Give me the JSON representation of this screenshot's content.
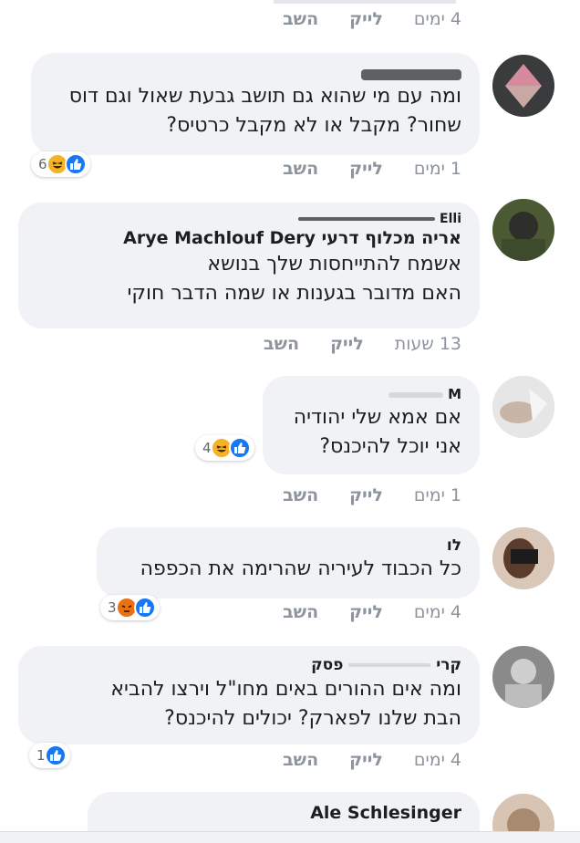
{
  "comments": [
    {
      "time": "4 ימים",
      "like": "לייק",
      "reply": "השב"
    },
    {
      "author": "",
      "text": "ומה עם מי שהוא גם תושב גבעת שאול וגם דוס\nשחור? מקבל או לא מקבל כרטיס?",
      "reaction_count": "6",
      "reactions": [
        "like-icon",
        "haha-icon"
      ],
      "time": "1 ימים",
      "like": "לייק",
      "reply": "השב"
    },
    {
      "author_top": "Elli",
      "author": "אריה מכלוף דרעי Arye Machlouf Dery",
      "text": "אשמח להתייחסות שלך בנושא\nהאם מדובר בגענות או שמה הדבר חוקי",
      "time": "13 שעות",
      "like": "לייק",
      "reply": "השב"
    },
    {
      "author": "M",
      "text": "אם אמא שלי יהודיה\nאני יוכל להיכנס?",
      "reaction_count": "4",
      "reactions": [
        "like-icon",
        "haha-icon"
      ],
      "time": "1 ימים",
      "like": "לייק",
      "reply": "השב"
    },
    {
      "author": "לו",
      "text": "כל הכבוד לעיריה שהרימה את הכפפה",
      "reaction_count": "3",
      "reactions": [
        "like-icon",
        "angry-icon"
      ],
      "time": "4 ימים",
      "like": "לייק",
      "reply": "השב"
    },
    {
      "author": "קרי",
      "author_tail": "פסק",
      "text": "ומה אים ההורים באים מחו\"ל וירצו להביא\nהבת שלנו לפארק? יכולים להיכנס?",
      "reaction_count": "1",
      "reactions": [
        "like-icon"
      ],
      "time": "4 ימים",
      "like": "לייק",
      "reply": "השב"
    },
    {
      "author": "Ale Schlesinger"
    }
  ],
  "colors": {
    "like": "#1877f2",
    "haha": "#f7b125",
    "angry": "#e9710f",
    "bubble": "#f0f2f5",
    "meta": "#8d949e"
  }
}
